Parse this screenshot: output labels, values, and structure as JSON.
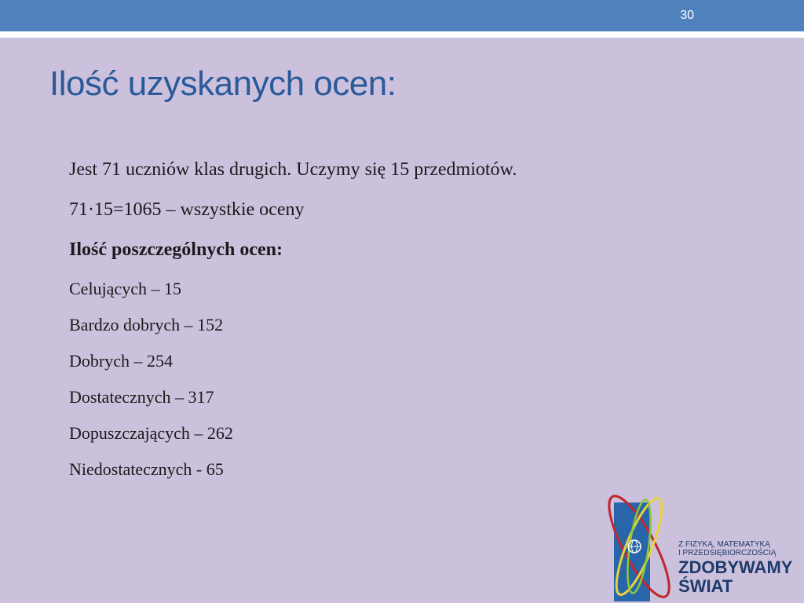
{
  "slide": {
    "number": "30",
    "title": "Ilość uzyskanych ocen:"
  },
  "content": {
    "intro": "Jest 71 uczniów klas drugich. Uczymy się 15 przedmiotów.",
    "formula": "71·15=1065 – wszystkie oceny",
    "subheading": "Ilość poszczególnych ocen:",
    "grades": [
      "Celujących – 15",
      "Bardzo dobrych – 152",
      "Dobrych – 254",
      "Dostatecznych – 317",
      "Dopuszczających – 262",
      "Niedostatecznych - 65"
    ]
  },
  "logo": {
    "tagline_line1": "Z FIZYKĄ, MATEMATYKĄ",
    "tagline_line2": "I PRZEDSIĘBIORCZOŚCIĄ",
    "brand_line1": "ZDOBYWAMY",
    "brand_line2": "ŚWIAT",
    "colors": {
      "blue": "#2b6cb3",
      "red": "#c1272d",
      "yellow": "#e9d23c",
      "green": "#8dc63f"
    }
  },
  "theme": {
    "background": "#cbc1dc",
    "accent_bar": "#4f81bd",
    "title_color": "#2a5a9a"
  }
}
